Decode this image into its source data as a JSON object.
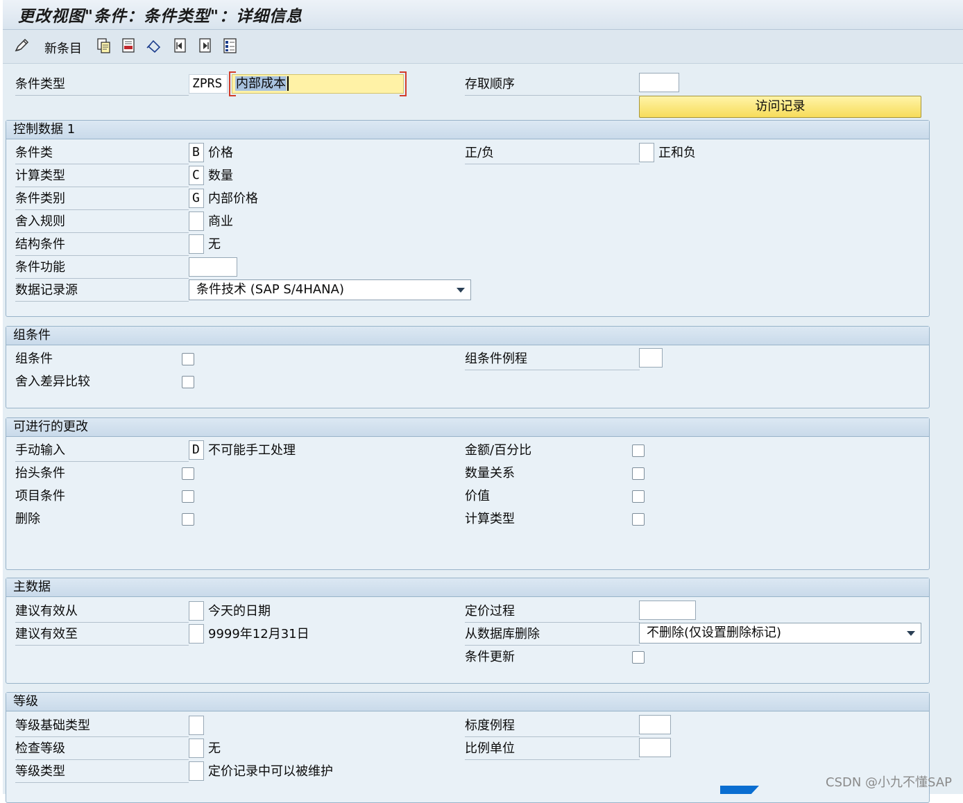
{
  "window": {
    "title": "更改视图\"条件：条件类型\"：详细信息"
  },
  "toolbar": {
    "new_entry_label": "新条目",
    "icons": [
      "change-icon",
      "copy-icon",
      "delete-icon",
      "undo-icon",
      "previous-entry-icon",
      "next-entry-icon",
      "select-all-icon"
    ]
  },
  "header": {
    "condition_type_label": "条件类型",
    "condition_type_code": "ZPRS",
    "condition_type_name": "内部成本",
    "access_sequence_label": "存取顺序",
    "access_sequence_value": "",
    "records_button": "访问记录"
  },
  "control1": {
    "title": "控制数据 1",
    "cond_class_label": "条件类",
    "cond_class_code": "B",
    "cond_class_text": "价格",
    "calc_type_label": "计算类型",
    "calc_type_code": "C",
    "calc_type_text": "数量",
    "cond_category_label": "条件类别",
    "cond_category_code": "G",
    "cond_category_text": "内部价格",
    "rounding_label": "舍入规则",
    "rounding_code": "",
    "rounding_text": "商业",
    "struct_label": "结构条件",
    "struct_code": "",
    "struct_text": "无",
    "function_label": "条件功能",
    "function_value": "",
    "source_label": "数据记录源",
    "source_value": "条件技术 (SAP S/4HANA)",
    "plus_minus_label": "正/负",
    "plus_minus_code": "",
    "plus_minus_text": "正和负"
  },
  "group": {
    "title": "组条件",
    "group_cond_label": "组条件",
    "round_diff_label": "舍入差异比较",
    "group_routine_label": "组条件例程",
    "group_routine_value": ""
  },
  "changes": {
    "title": "可进行的更改",
    "manual_label": "手动输入",
    "manual_code": "D",
    "manual_text": "不可能手工处理",
    "header_cond_label": "抬头条件",
    "item_cond_label": "项目条件",
    "delete_label": "删除",
    "amount_pct_label": "金额/百分比",
    "qty_relation_label": "数量关系",
    "value_label": "价值",
    "calc_type_label": "计算类型"
  },
  "master": {
    "title": "主数据",
    "valid_from_label": "建议有效从",
    "valid_from_text": "今天的日期",
    "valid_to_label": "建议有效至",
    "valid_to_text": "9999年12月31日",
    "pricing_proc_label": "定价过程",
    "pricing_proc_value": "",
    "delete_db_label": "从数据库删除",
    "delete_db_value": "不删除(仅设置删除标记)",
    "cond_update_label": "条件更新"
  },
  "scales": {
    "title": "等级",
    "scale_base_label": "等级基础类型",
    "check_scale_label": "检查等级",
    "check_scale_text": "无",
    "scale_type_label": "等级类型",
    "scale_type_text": "定价记录中可以被维护",
    "scale_routine_label": "标度例程",
    "scale_unit_label": "比例单位"
  },
  "watermark": "CSDN @小九不懂SAP"
}
